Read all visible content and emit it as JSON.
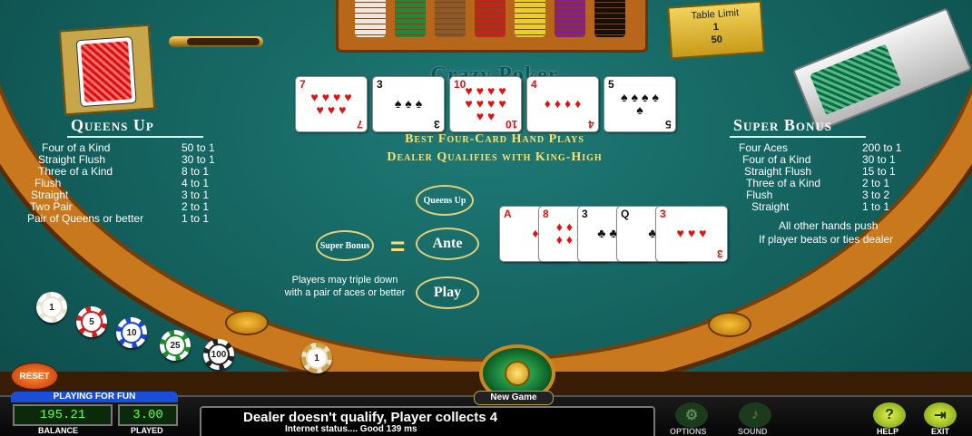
{
  "game": {
    "title": "Crazy Poker"
  },
  "table_limit": {
    "label": "Table Limit",
    "min": "1",
    "max": "50"
  },
  "queens_up": {
    "title": "Queens Up",
    "rows": [
      {
        "hand": "Four of a Kind",
        "pays": "50 to 1"
      },
      {
        "hand": "Straight Flush",
        "pays": "30 to 1"
      },
      {
        "hand": "Three of a Kind",
        "pays": "8 to 1"
      },
      {
        "hand": "Flush",
        "pays": "4 to 1"
      },
      {
        "hand": "Straight",
        "pays": "3 to 1"
      },
      {
        "hand": "Two Pair",
        "pays": "2 to 1"
      },
      {
        "hand": "Pair of Queens or better",
        "pays": "1 to 1"
      }
    ]
  },
  "super_bonus": {
    "title": "Super Bonus",
    "rows": [
      {
        "hand": "Four Aces",
        "pays": "200 to 1"
      },
      {
        "hand": "Four of a Kind",
        "pays": "30 to 1"
      },
      {
        "hand": "Straight Flush",
        "pays": "15 to 1"
      },
      {
        "hand": "Three of a Kind",
        "pays": "2 to 1"
      },
      {
        "hand": "Flush",
        "pays": "3 to 2"
      },
      {
        "hand": "Straight",
        "pays": "1 to 1"
      }
    ],
    "note1": "All other hands push",
    "note2": "If player beats or ties dealer"
  },
  "rules": {
    "line1": "Best Four-Card Hand Plays",
    "line2": "Dealer Qualifies with King-High"
  },
  "bets": {
    "queens_up": "Queens Up",
    "super_bonus": "Super Bonus",
    "equals": "=",
    "ante": "Ante",
    "play": "Play",
    "triple_note": "Players may triple down with a pair of aces or better"
  },
  "dealer_cards": [
    {
      "rank": "7",
      "suit": "♥",
      "color": "red",
      "pips": 7
    },
    {
      "rank": "3",
      "suit": "♠",
      "color": "black",
      "pips": 3
    },
    {
      "rank": "10",
      "suit": "♥",
      "color": "red",
      "pips": 10
    },
    {
      "rank": "4",
      "suit": "♦",
      "color": "red",
      "pips": 4
    },
    {
      "rank": "5",
      "suit": "♠",
      "color": "black",
      "pips": 5
    }
  ],
  "player_cards": [
    {
      "rank": "A",
      "suit": "♦",
      "color": "red",
      "pips": 1
    },
    {
      "rank": "8",
      "suit": "♦",
      "color": "red",
      "pips": 8
    },
    {
      "rank": "3",
      "suit": "♣",
      "color": "black",
      "pips": 3
    },
    {
      "rank": "Q",
      "suit": "♣",
      "color": "black",
      "pips": 1
    },
    {
      "rank": "3",
      "suit": "♥",
      "color": "red",
      "pips": 3
    }
  ],
  "chips": [
    {
      "value": "1",
      "color": "#e9e2cf"
    },
    {
      "value": "5",
      "color": "#d41c1c"
    },
    {
      "value": "10",
      "color": "#1c44d4"
    },
    {
      "value": "25",
      "color": "#1e8a2a"
    },
    {
      "value": "100",
      "color": "#222222"
    }
  ],
  "bet_chip": "1",
  "tray_colors": [
    "#e8e8e8",
    "#1b8a3a",
    "#8a5a2a",
    "#cc2020",
    "#e6d020",
    "#8a1a9a",
    "#111111"
  ],
  "controls": {
    "reset": "RESET",
    "playing_for_fun": "PLAYING FOR FUN",
    "balance_value": "195.21",
    "balance_label": "BALANCE",
    "played_value": "3.00",
    "played_label": "PLAYED",
    "message": "Dealer doesn't qualify, Player collects 4",
    "status": "Internet status.... Good 139 ms",
    "new_game": "New Game",
    "options": "OPTIONS",
    "sound": "SOUND",
    "help": "HELP",
    "exit": "EXIT"
  }
}
